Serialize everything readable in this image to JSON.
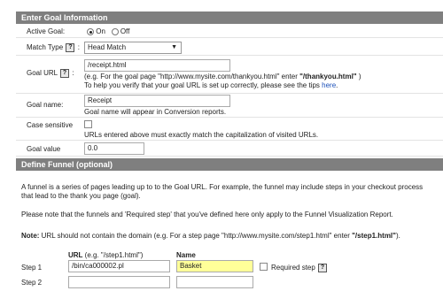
{
  "goal_section": {
    "title": "Enter Goal Information",
    "active_goal": {
      "label": "Active Goal:",
      "on_label": "On",
      "off_label": "Off"
    },
    "match_type": {
      "label": "Match Type",
      "colon": ":",
      "value": "Head Match",
      "help": "?"
    },
    "goal_url": {
      "label": "Goal URL",
      "colon": ":",
      "help": "?",
      "value": "/receipt.html",
      "hint_prefix": "(e.g. For the goal page \"http://www.mysite.com/thankyou.html\" enter ",
      "hint_bold": "\"/thankyou.html\"",
      "hint_suffix": " )",
      "tip_text": "To help you verify that your goal URL is set up correctly, please see the tips ",
      "tip_link": "here",
      "tip_end": "."
    },
    "goal_name": {
      "label": "Goal name:",
      "value": "Receipt",
      "hint": "Goal name will appear in Conversion reports."
    },
    "case_sensitive": {
      "label": "Case sensitive",
      "hint": "URLs entered above must exactly match the capitalization of visited URLs."
    },
    "goal_value": {
      "label": "Goal value",
      "value": "0.0"
    }
  },
  "funnel_section": {
    "title": "Define Funnel (optional)",
    "para1_line1": "A funnel is a series of pages leading up to to the Goal URL. For example, the funnel may include steps in your checkout process",
    "para1_line2": "that lead to the thank you page (goal).",
    "para2": "Please note that the funnels and 'Required step' that you've defined here only apply to the Funnel Visualization Report.",
    "note_bold": "Note:",
    "note_text": " URL should not contain the domain (e.g. For a step page \"http://www.mysite.com/step1.html\" enter ",
    "note_example": "\"/step1.html\"",
    "note_end": ").",
    "url_header": "URL",
    "url_header_hint": " (e.g. \"/step1.html\")",
    "name_header": "Name",
    "steps": [
      {
        "label": "Step 1",
        "url": "/bin/ca000002.pl",
        "name": "Basket",
        "required_label": "Required step",
        "help": "?"
      },
      {
        "label": "Step 2",
        "url": "",
        "name": ""
      }
    ]
  }
}
